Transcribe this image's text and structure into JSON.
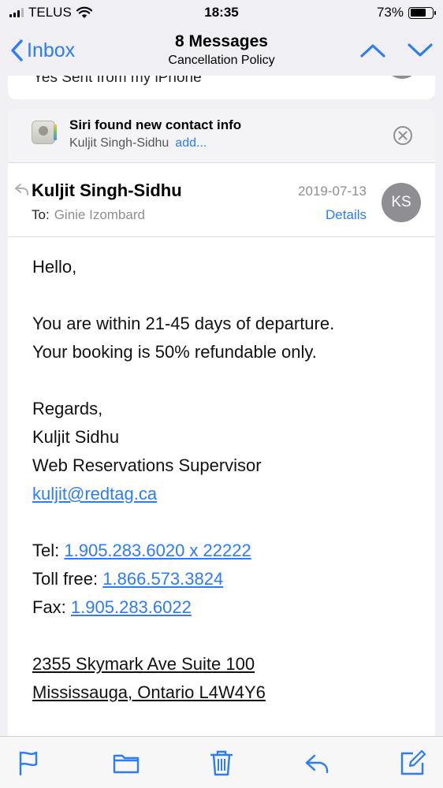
{
  "status_bar": {
    "carrier": "TELUS",
    "time": "18:35",
    "battery_percent": "73%",
    "battery_level": 0.73
  },
  "nav": {
    "back_label": "Inbox",
    "title": "8 Messages",
    "subtitle": "Cancellation Policy"
  },
  "previous_message": {
    "snippet": "Yes Sent from my iPhone"
  },
  "siri_suggestion": {
    "title": "Siri found new contact info",
    "contact_name": "Kuljit Singh-Sidhu",
    "add_label": "add..."
  },
  "message": {
    "sender": "Kuljit Singh-Sidhu",
    "to_label": "To:",
    "recipient": "Ginie Izombard",
    "date": "2019-07-13",
    "details_label": "Details",
    "avatar_initials": "KS",
    "body": {
      "greeting": "Hello,",
      "line1": "You are within 21-45 days of departure.",
      "line2": "Your booking is 50% refundable only.",
      "regards": "Regards,",
      "sig_name": "Kuljit Sidhu",
      "sig_title": "Web Reservations Supervisor",
      "email": "kuljit@redtag.ca",
      "tel_label": "Tel:",
      "tel": "1.905.283.6020 x 22222",
      "tollfree_label": "Toll free:",
      "tollfree": "1.866.573.3824",
      "fax_label": "Fax:",
      "fax": "1.905.283.6022",
      "address1": "2355 Skymark Ave Suite 100",
      "address2": "Mississauga, Ontario L4W4Y6"
    }
  },
  "toolbar": {
    "icons": [
      "flag-icon",
      "folder-icon",
      "trash-icon",
      "reply-icon",
      "compose-icon"
    ]
  },
  "colors": {
    "accent": "#2b7cf6",
    "gray": "#8e8e93"
  }
}
